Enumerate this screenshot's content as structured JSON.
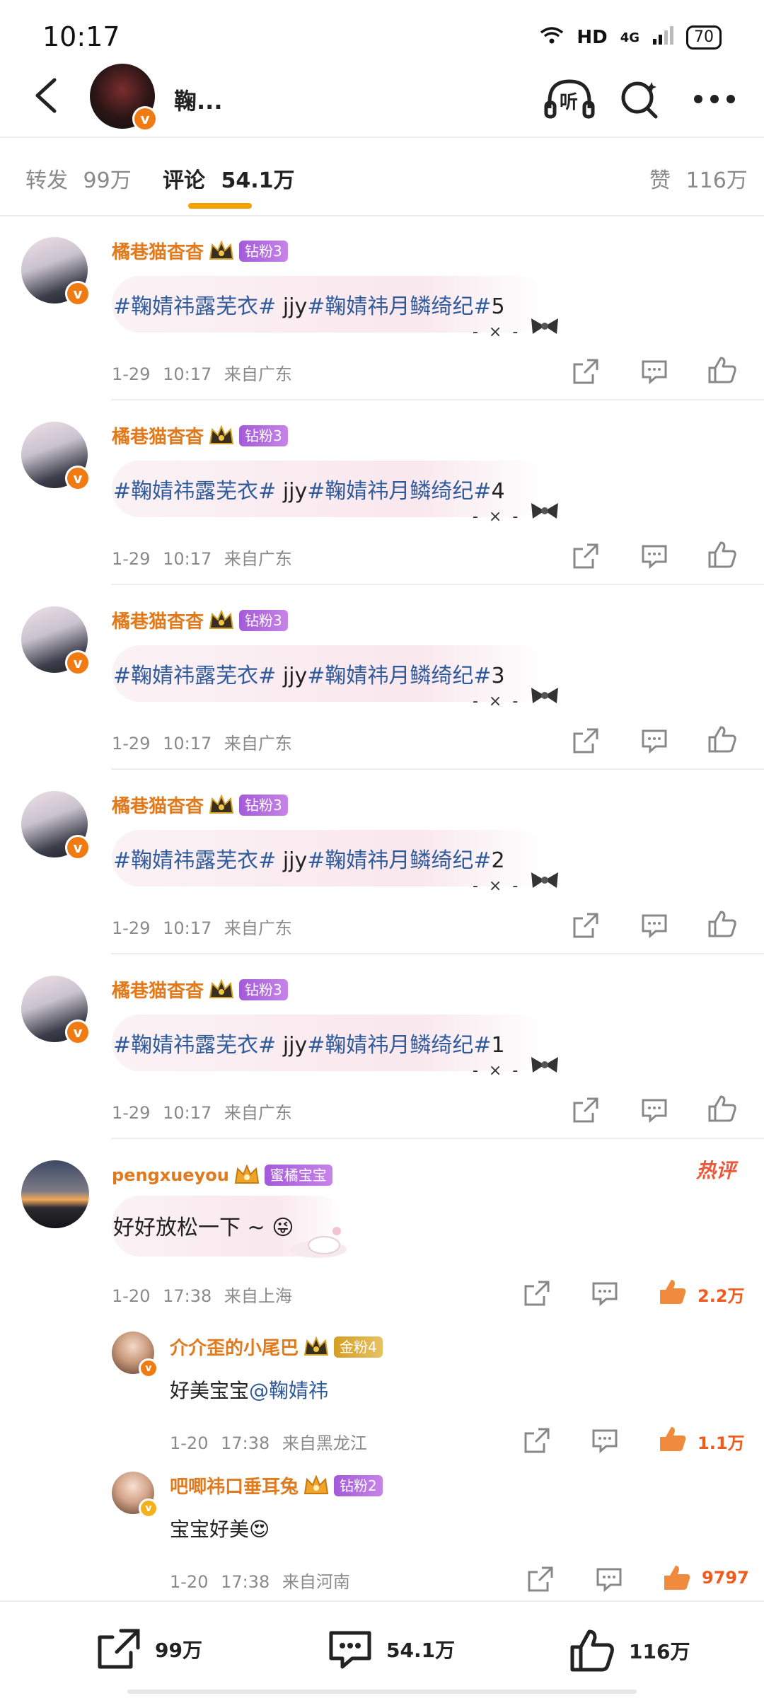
{
  "status_bar": {
    "time": "10:17",
    "network": "HD",
    "network_type": "4G",
    "battery": "70"
  },
  "header": {
    "title": "鞠...",
    "listen_label": "听"
  },
  "tabs": {
    "repost_label": "转发",
    "repost_count": "99万",
    "comment_label": "评论",
    "comment_count": "54.1万",
    "like_label": "赞",
    "like_count": "116万"
  },
  "comments": [
    {
      "user": "橘巷猫杳杳",
      "badge": "钻粉3",
      "tag1": "#鞠婧祎露芜衣#",
      "mid": " jjy",
      "tag2": "#鞠婧祎月鳞绮纪#",
      "num": "5",
      "date": "1-29",
      "time": "10:17",
      "location": "来自广东"
    },
    {
      "user": "橘巷猫杳杳",
      "badge": "钻粉3",
      "tag1": "#鞠婧祎露芜衣#",
      "mid": " jjy",
      "tag2": "#鞠婧祎月鳞绮纪#",
      "num": "4",
      "date": "1-29",
      "time": "10:17",
      "location": "来自广东"
    },
    {
      "user": "橘巷猫杳杳",
      "badge": "钻粉3",
      "tag1": "#鞠婧祎露芜衣#",
      "mid": " jjy",
      "tag2": "#鞠婧祎月鳞绮纪#",
      "num": "3",
      "date": "1-29",
      "time": "10:17",
      "location": "来自广东"
    },
    {
      "user": "橘巷猫杳杳",
      "badge": "钻粉3",
      "tag1": "#鞠婧祎露芜衣#",
      "mid": " jjy",
      "tag2": "#鞠婧祎月鳞绮纪#",
      "num": "2",
      "date": "1-29",
      "time": "10:17",
      "location": "来自广东"
    },
    {
      "user": "橘巷猫杳杳",
      "badge": "钻粉3",
      "tag1": "#鞠婧祎露芜衣#",
      "mid": " jjy",
      "tag2": "#鞠婧祎月鳞绮纪#",
      "num": "1",
      "date": "1-29",
      "time": "10:17",
      "location": "来自广东"
    }
  ],
  "hot_comment": {
    "user": "pengxueyou",
    "badge": "蜜橘宝宝",
    "hot_label": "热评",
    "text": "好好放松一下 ~ 😜",
    "date": "1-20",
    "time": "17:38",
    "location": "来自上海",
    "likes": "2.2万",
    "replies": [
      {
        "user": "介介歪的小尾巴",
        "badge": "金粉4",
        "text": "好美宝宝",
        "mention": "@鞠婧祎",
        "date": "1-20",
        "time": "17:38",
        "location": "来自黑龙江",
        "likes": "1.1万"
      },
      {
        "user": "吧唧祎口垂耳兔",
        "badge": "钻粉2",
        "text": "宝宝好美😍",
        "date": "1-20",
        "time": "17:38",
        "location": "来自河南",
        "likes": "9797"
      }
    ]
  },
  "bottom_bar": {
    "repost_count": "99万",
    "comment_count": "54.1万",
    "like_count": "116万"
  },
  "colors": {
    "accent": "#f5a000",
    "username": "#e07a1c",
    "topic": "#2f5a9b",
    "like_active": "#ef5a1e"
  }
}
